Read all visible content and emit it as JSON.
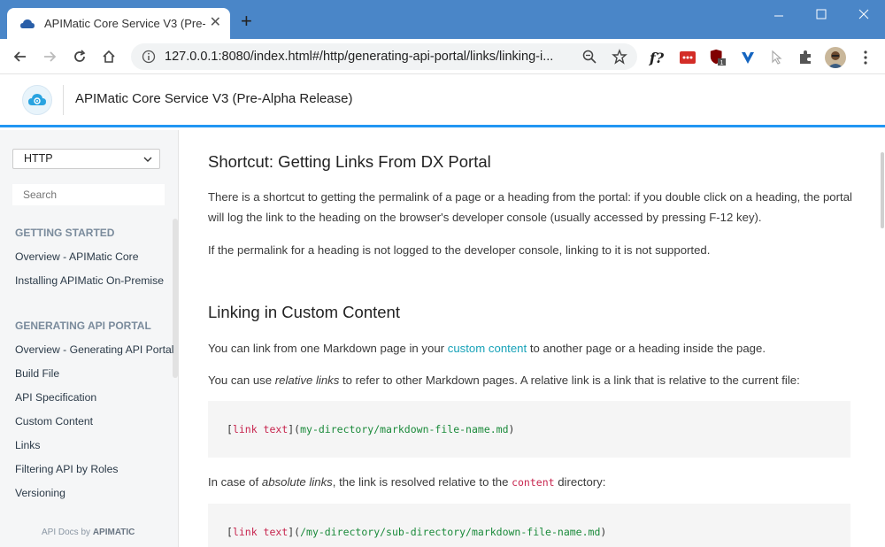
{
  "browser": {
    "tab_title": "APIMatic Core Service V3 (Pre-Alpha Release)",
    "url": "127.0.0.1:8080/index.html#/http/generating-api-portal/links/linking-i...",
    "new_tab_label": "+",
    "close_tab_label": "✕",
    "extension_f_label": "f?"
  },
  "app": {
    "title": "APIMatic Core Service V3 (Pre-Alpha Release)"
  },
  "sidebar": {
    "language_select": "HTTP",
    "search_placeholder": "Search",
    "sections": [
      {
        "heading": "GETTING STARTED",
        "items": [
          "Overview - APIMatic Core",
          "Installing APIMatic On-Premise"
        ]
      },
      {
        "heading": "GENERATING API PORTAL",
        "items": [
          "Overview - Generating API Portal",
          "Build File",
          "API Specification",
          "Custom Content",
          "Links",
          "Filtering API by Roles",
          "Versioning"
        ]
      }
    ],
    "footer_prefix": "API Docs by",
    "footer_brand": "APIMATIC"
  },
  "content": {
    "shortcut_heading": "Shortcut: Getting Links From DX Portal",
    "shortcut_p1": "There is a shortcut to getting the permalink of a page or a heading from the portal: if you double click on a heading, the portal will log the link to the heading on the browser's developer console (usually accessed by pressing F-12 key).",
    "shortcut_p2": "If the permalink for a heading is not logged to the developer console, linking to it is not supported.",
    "custom_heading": "Linking in Custom Content",
    "custom_p1_before": "You can link from one Markdown page in your ",
    "custom_p1_link": "custom content",
    "custom_p1_after": " to another page or a heading inside the page.",
    "custom_p2_before": "You can use ",
    "custom_p2_em": "relative links",
    "custom_p2_after": " to refer to other Markdown pages. A relative link is a link that is relative to the current file:",
    "code1": {
      "open": "[",
      "text": "link text",
      "mid": "](",
      "url": "my-directory/markdown-file-name.md",
      "close": ")"
    },
    "absolute_p_before": "In case of ",
    "absolute_p_em": "absolute links",
    "absolute_p_mid": ", the link is resolved relative to the ",
    "absolute_p_code": "content",
    "absolute_p_after": " directory:",
    "code2": {
      "open": "[",
      "text": "link text",
      "mid": "](",
      "url": "/my-directory/sub-directory/markdown-file-name.md",
      "close": ")"
    }
  },
  "colors": {
    "titlebar": "#4a86c8",
    "accent": "#2196f3",
    "link": "#17a2b8",
    "code_text": "#c7254e",
    "code_url": "#1a8a3a"
  }
}
